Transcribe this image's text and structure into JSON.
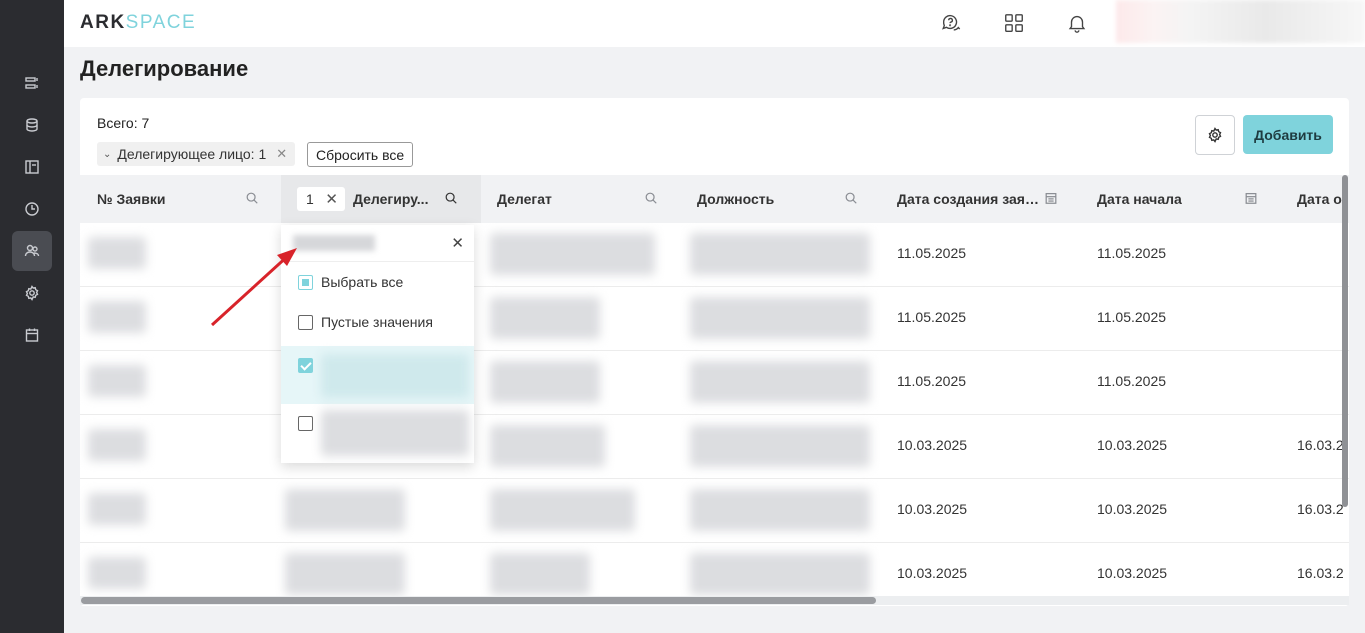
{
  "app": {
    "logo_ark": "ARK",
    "logo_space": "SPACE"
  },
  "sidebar": {
    "items": [
      {
        "icon": "list-icon"
      },
      {
        "icon": "database-icon"
      },
      {
        "icon": "layout-icon"
      },
      {
        "icon": "clock-icon"
      },
      {
        "icon": "users-icon",
        "active": true
      },
      {
        "icon": "gear-icon"
      },
      {
        "icon": "calendar-icon"
      }
    ]
  },
  "topbar": {
    "icons": [
      "help-chat-icon",
      "apps-grid-icon",
      "bell-icon"
    ]
  },
  "page": {
    "title": "Делегирование"
  },
  "toolbar": {
    "total": "Всего: 7",
    "filter_chip": "Делегирующее лицо: 1",
    "reset_label": "Сбросить все",
    "add_label": "Добавить"
  },
  "table": {
    "columns": [
      {
        "label": "№ Заявки",
        "icon": "search-icon"
      },
      {
        "label": "Делегиру...",
        "icon": "search-icon",
        "filter_count": "1"
      },
      {
        "label": "Делегат",
        "icon": "search-icon"
      },
      {
        "label": "Должность",
        "icon": "search-icon"
      },
      {
        "label": "Дата создания заяв...",
        "icon": "calendar-icon"
      },
      {
        "label": "Дата начала",
        "icon": "calendar-icon"
      },
      {
        "label": "Дата о",
        "icon": ""
      }
    ],
    "rows": [
      {
        "created": "11.05.2025",
        "start": "11.05.2025",
        "end": ""
      },
      {
        "created": "11.05.2025",
        "start": "11.05.2025",
        "end": ""
      },
      {
        "created": "11.05.2025",
        "start": "11.05.2025",
        "end": ""
      },
      {
        "created": "10.03.2025",
        "start": "10.03.2025",
        "end": "16.03.2"
      },
      {
        "created": "10.03.2025",
        "start": "10.03.2025",
        "end": "16.03.2"
      },
      {
        "created": "10.03.2025",
        "start": "10.03.2025",
        "end": "16.03.2"
      }
    ]
  },
  "filter_dropdown": {
    "select_all": "Выбрать все",
    "empty_values": "Пустые значения"
  },
  "colors": {
    "accent": "#7fd3dc",
    "sidebar": "#2b2c30"
  }
}
